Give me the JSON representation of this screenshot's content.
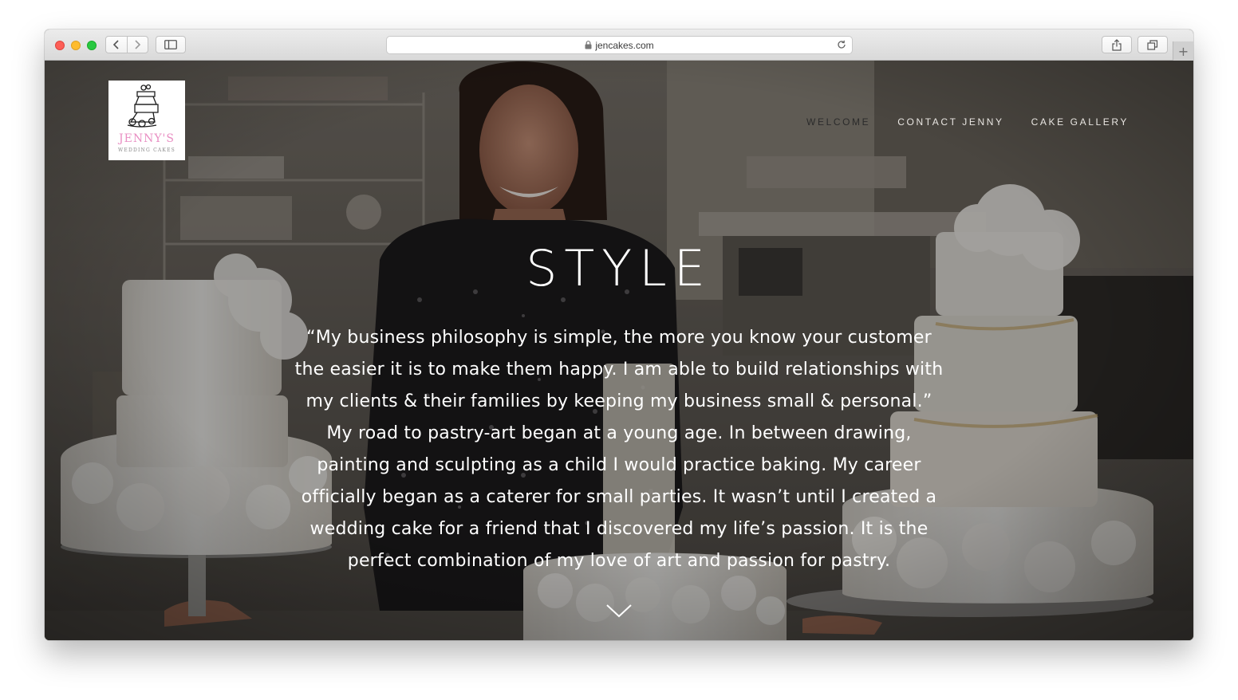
{
  "browser": {
    "url": "jencakes.com",
    "new_tab_label": "+"
  },
  "site": {
    "logo": {
      "name": "JENNY'S",
      "tagline": "WEDDING CAKES"
    },
    "nav": [
      {
        "label": "WELCOME",
        "active": true
      },
      {
        "label": "CONTACT JENNY",
        "active": false
      },
      {
        "label": "CAKE GALLERY",
        "active": false
      }
    ],
    "hero": {
      "title": "STYLE",
      "quote": "“My business philosophy is simple, the more you know your customer the easier it is to make them happy.  I am able to build relationships with my clients & their families by keeping my business small & personal.”",
      "paragraph": "My road to pastry-art began at a young age.  In between drawing, painting and sculpting as a child I would practice baking.  My career officially began as a caterer for small parties.  It wasn’t until I created a wedding cake for a friend that I discovered my life’s passion.  It is the perfect combination of my love of art and passion for pastry."
    }
  },
  "colors": {
    "traffic_red": "#fd5f57",
    "traffic_yellow": "#febc2e",
    "traffic_green": "#28c840",
    "logo_pink": "#e98fc3",
    "nav_text": "#e9e6e2",
    "nav_active": "#2b2b2b"
  }
}
